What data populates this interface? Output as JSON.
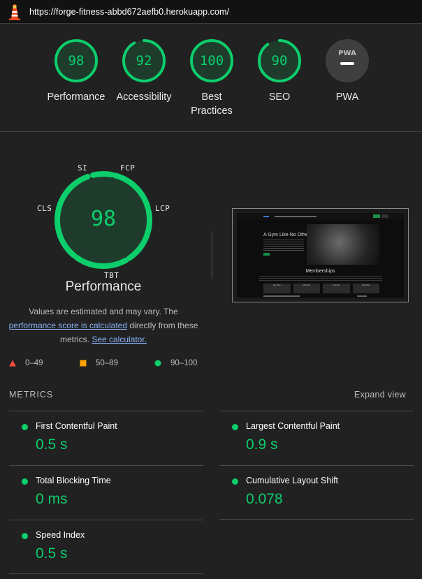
{
  "url": "https://forge-fitness-abbd672aefb0.herokuapp.com/",
  "colors": {
    "pass": "#0cce6b",
    "pass_bg": "#1e3b2c",
    "average": "#ffa400",
    "fail": "#ff4e42",
    "na": "#3f3f3f"
  },
  "categories": [
    {
      "label": "Performance",
      "score": "98",
      "value": 0.98
    },
    {
      "label": "Accessibility",
      "score": "92",
      "value": 0.92
    },
    {
      "label": "Best Practices",
      "score": "100",
      "value": 1.0
    },
    {
      "label": "SEO",
      "score": "90",
      "value": 0.9
    },
    {
      "label": "PWA",
      "badge": "PWA",
      "icon": "pwa-badge-icon"
    }
  ],
  "performance": {
    "score": "98",
    "title": "Performance",
    "gauge_labels": [
      "SI",
      "FCP",
      "LCP",
      "TBT",
      "CLS"
    ],
    "note_prefix": "Values are estimated and may vary. The",
    "note_link": "performance score is calculated",
    "note_mid": "directly from these metrics.",
    "note_calc_link": "See calculator."
  },
  "legend": [
    {
      "range": "0–49",
      "icon": "triangle-fail-icon"
    },
    {
      "range": "50–89",
      "icon": "square-average-icon"
    },
    {
      "range": "90–100",
      "icon": "circle-pass-icon"
    }
  ],
  "metrics_header": "METRICS",
  "expand_view": "Expand view",
  "metrics": [
    {
      "name": "First Contentful Paint",
      "value": "0.5 s"
    },
    {
      "name": "Largest Contentful Paint",
      "value": "0.9 s"
    },
    {
      "name": "Total Blocking Time",
      "value": "0 ms"
    },
    {
      "name": "Cumulative Layout Shift",
      "value": "0.078"
    },
    {
      "name": "Speed Index",
      "value": "0.5 s"
    }
  ],
  "screenshot": {
    "headline": "A Gym Like No Other",
    "section": "Memberships",
    "plans": [
      "My Plan",
      "Monthly",
      "Annual",
      "Full Plan"
    ]
  }
}
